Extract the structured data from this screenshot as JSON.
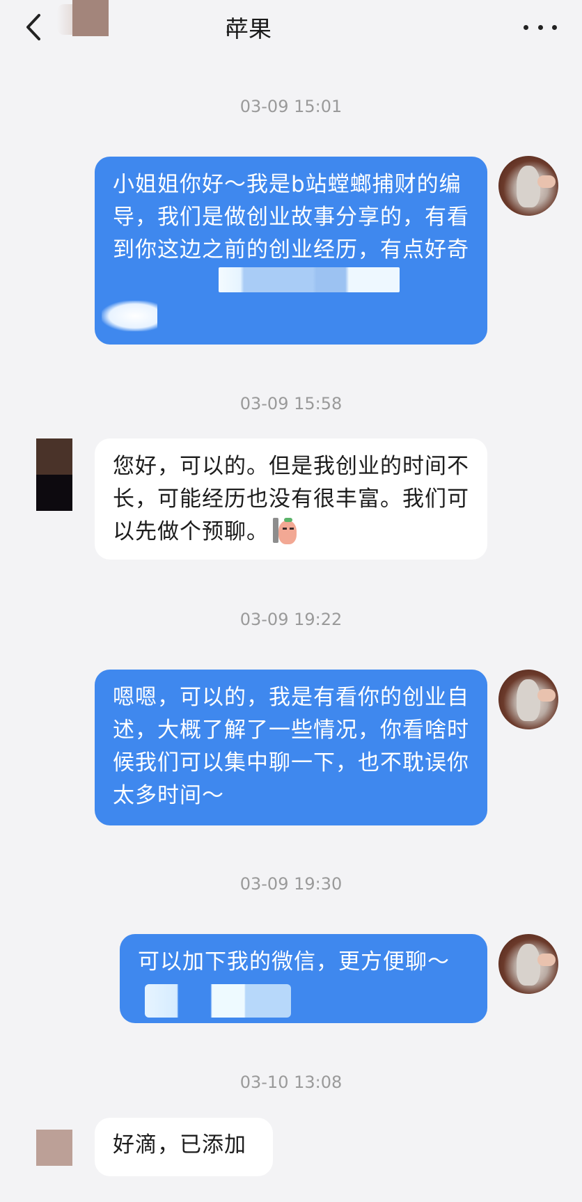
{
  "header": {
    "title": "苹果",
    "back_icon": "chevron-left-icon",
    "more_icon": "more-horizontal-icon"
  },
  "colors": {
    "my_bubble": "#3f88ee",
    "their_bubble": "#ffffff",
    "background": "#f3f3f5",
    "timestamp": "#9a9a9a"
  },
  "messages": [
    {
      "timestamp": "03-09 15:01",
      "sender": "me",
      "text": "小姐姐你好～我是b站螳螂捕财的编导，我们是做创业故事分享的，有看到你这边之前的创业经历，有点好奇"
    },
    {
      "timestamp": "03-09 15:58",
      "sender": "them",
      "text": "您好，可以的。但是我创业的时间不长，可能经历也没有很丰富。我们可以先做个预聊。",
      "sticker": "sticker-emoji-icon"
    },
    {
      "timestamp": "03-09 19:22",
      "sender": "me",
      "text": "嗯嗯，可以的，我是有看你的创业自述，大概了解了一些情况，你看啥时候我们可以集中聊一下，也不耽误你太多时间～"
    },
    {
      "timestamp": "03-09 19:30",
      "sender": "me",
      "text": "可以加下我的微信，更方便聊～"
    },
    {
      "timestamp": "03-10 13:08",
      "sender": "them",
      "text": "好滴，已添加"
    }
  ]
}
